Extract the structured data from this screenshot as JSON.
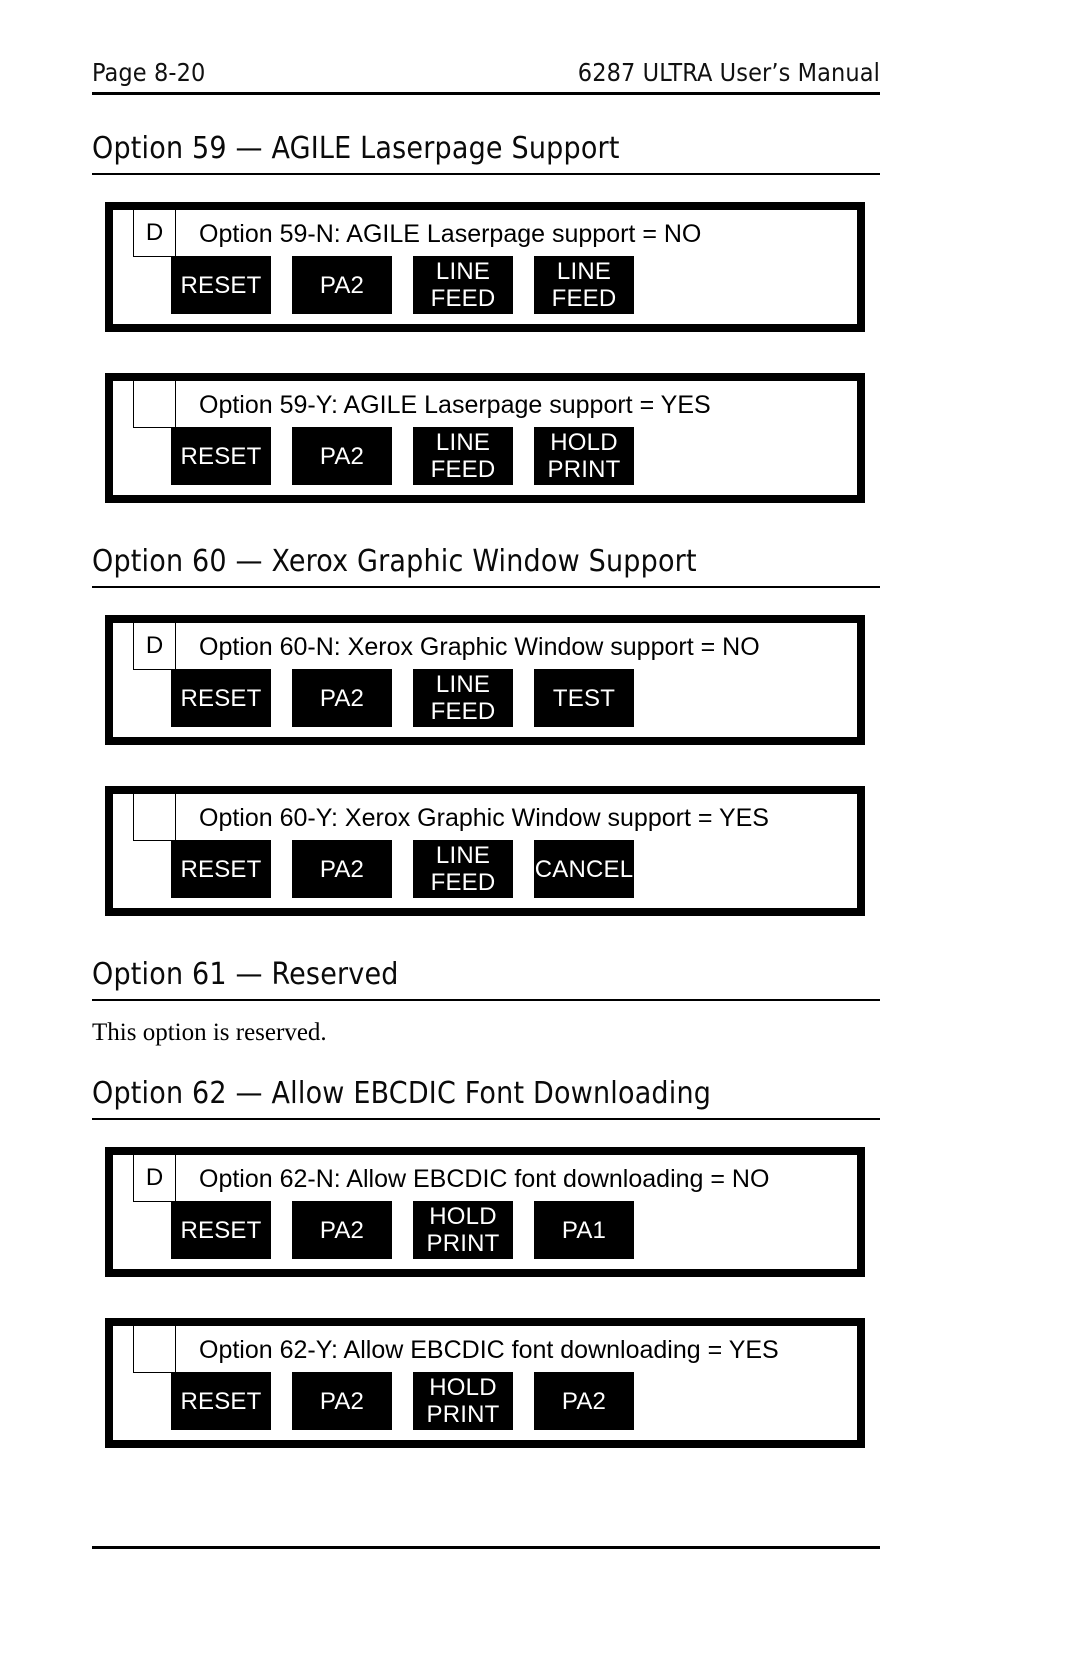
{
  "header": {
    "page_label": "Page 8-20",
    "manual_title": "6287 ULTRA User’s Manual"
  },
  "sections": [
    {
      "heading": "Option 59 — AGILE Laserpage Support",
      "panels": [
        {
          "tag": "D",
          "message": "Option 59-N: AGILE Laserpage support = NO",
          "keys": [
            "RESET",
            "PA2",
            "LINE\nFEED",
            "LINE\nFEED"
          ]
        },
        {
          "tag": "",
          "message": "Option 59-Y: AGILE Laserpage support = YES",
          "keys": [
            "RESET",
            "PA2",
            "LINE\nFEED",
            "HOLD\nPRINT"
          ]
        }
      ]
    },
    {
      "heading": "Option 60 — Xerox Graphic Window Support",
      "panels": [
        {
          "tag": "D",
          "message": "Option 60-N: Xerox Graphic Window support = NO",
          "keys": [
            "RESET",
            "PA2",
            "LINE\nFEED",
            "TEST"
          ]
        },
        {
          "tag": "",
          "message": "Option 60-Y: Xerox Graphic Window support = YES",
          "keys": [
            "RESET",
            "PA2",
            "LINE\nFEED",
            "CANCEL"
          ]
        }
      ]
    },
    {
      "heading": "Option 61 — Reserved",
      "body": "This option is reserved.",
      "panels": []
    },
    {
      "heading": "Option 62 — Allow EBCDIC Font Downloading",
      "panels": [
        {
          "tag": "D",
          "message": "Option 62-N: Allow EBCDIC font downloading = NO",
          "keys": [
            "RESET",
            "PA2",
            "HOLD\nPRINT",
            "PA1"
          ]
        },
        {
          "tag": "",
          "message": "Option 62-Y: Allow EBCDIC font downloading = YES",
          "keys": [
            "RESET",
            "PA2",
            "HOLD\nPRINT",
            "PA2"
          ]
        }
      ]
    }
  ],
  "colors": {
    "key_fill": "#000000",
    "key_text": "#ffffff",
    "page_background": "#ffffff",
    "rule": "#000000"
  }
}
